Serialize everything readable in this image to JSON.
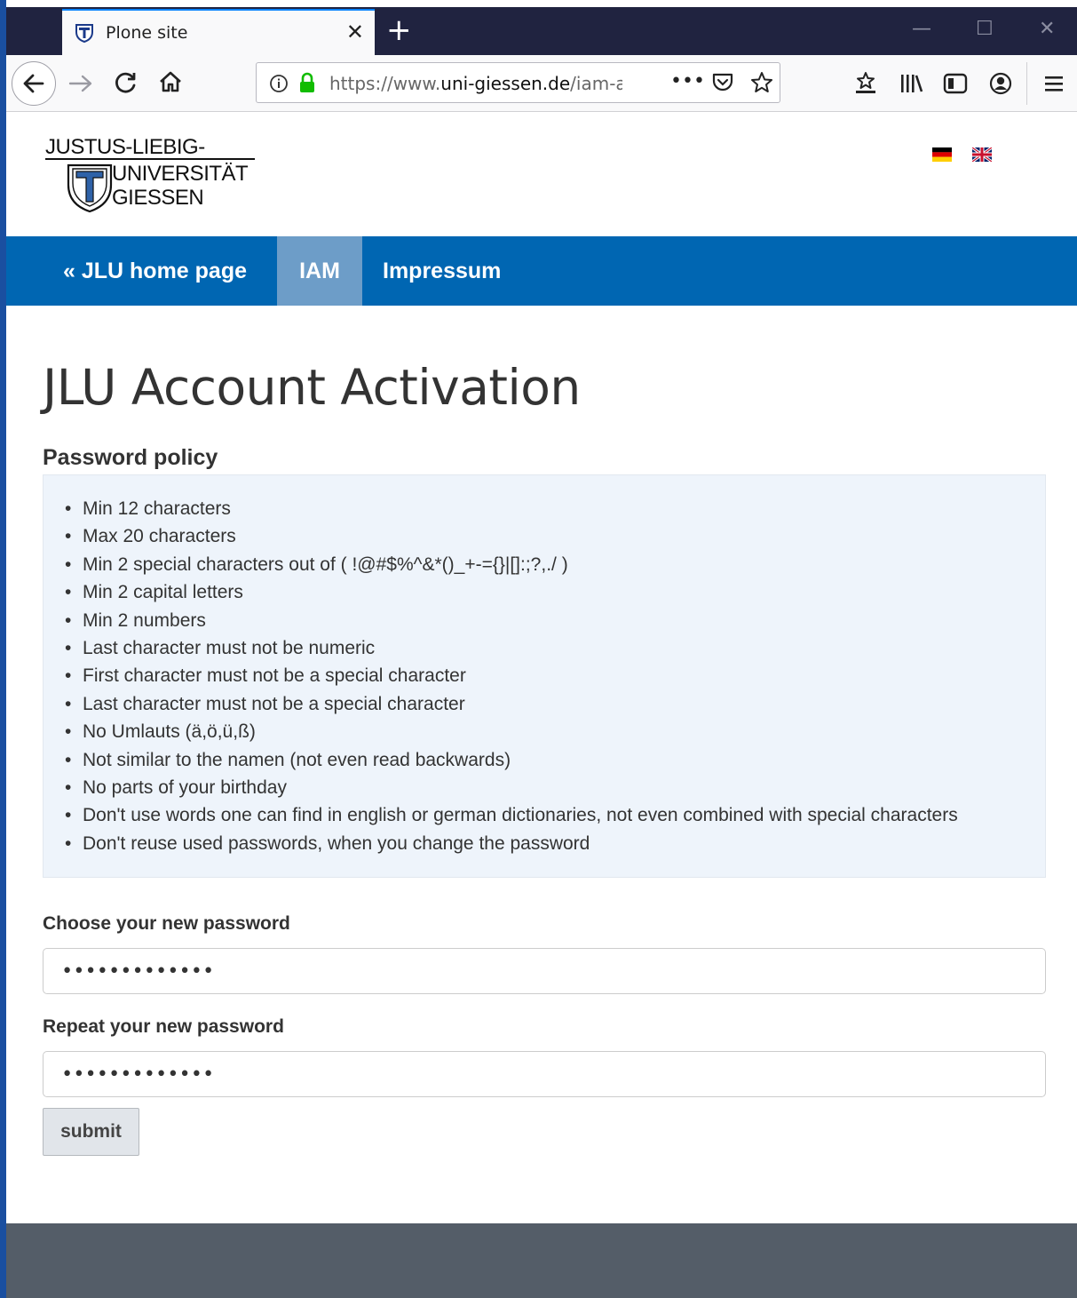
{
  "browser": {
    "tab_title": "Plone site",
    "tab_close": "✕",
    "new_tab": "+",
    "url_prefix": "https://www.",
    "url_domain": "uni-giessen.de",
    "url_path": "/iam-ac",
    "page_actions": "•••",
    "icons": [
      "back-icon",
      "forward-icon",
      "reload-icon",
      "home-icon",
      "info-icon",
      "lock-icon",
      "pocket-icon",
      "bookmark-star-icon",
      "bookmarks-icon",
      "library-icon",
      "sidebar-icon",
      "account-icon",
      "menu-icon"
    ]
  },
  "site": {
    "logo": {
      "line1": "JUSTUS-LIEBIG-",
      "line2": "UNIVERSITÄT",
      "line3": "GIESSEN"
    },
    "nav": [
      {
        "label": "« JLU home page"
      },
      {
        "label": "IAM",
        "active": true
      },
      {
        "label": "Impressum"
      }
    ]
  },
  "main": {
    "title": "JLU Account Activation",
    "policy_heading": "Password policy",
    "policy_items": [
      "Min 12 characters",
      "Max 20 characters",
      "Min 2 special characters out of ( !@#$%^&*()_+-={}|[]:;?,./ )",
      "Min 2 capital letters",
      "Min 2 numbers",
      "Last character must not be numeric",
      "First character must not be a special character",
      "Last character must not be a special character",
      "No Umlauts (ä,ö,ü,ß)",
      "Not similar to the namen (not even read backwards)",
      "No parts of your birthday",
      "Don't use words one can find in english or german dictionaries, not even combined with special characters",
      "Don't reuse used passwords, when you change the password"
    ],
    "new_password_label": "Choose your new password",
    "new_password_value": "•••••••••••••",
    "repeat_password_label": "Repeat your new password",
    "repeat_password_value": "•••••••••••••",
    "submit_label": "submit"
  },
  "colors": {
    "nav_bg": "#0066b2",
    "nav_active_bg": "#6d9dc8",
    "policy_bg": "#eef4fb",
    "footer_bg": "#545d68",
    "titlebar_bg": "#202340"
  }
}
